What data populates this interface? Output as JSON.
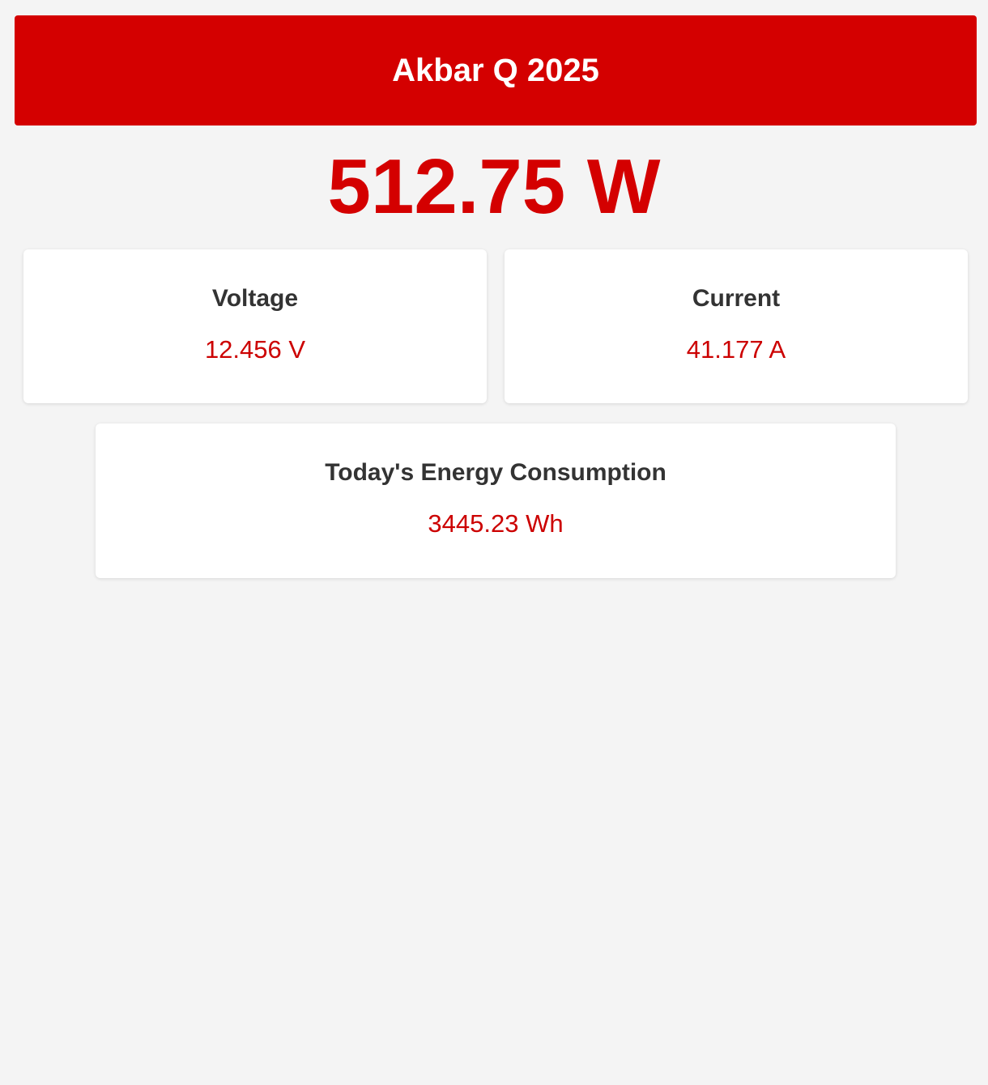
{
  "header": {
    "title": "Akbar Q 2025"
  },
  "power": {
    "value": "512.75 W"
  },
  "cards": {
    "voltage": {
      "title": "Voltage",
      "value": "12.456 V"
    },
    "current": {
      "title": "Current",
      "value": "41.177 A"
    },
    "energy": {
      "title": "Today's Energy Consumption",
      "value": "3445.23 Wh"
    }
  },
  "colors": {
    "accent": "#d40000",
    "background": "#f4f4f4",
    "card": "#ffffff",
    "heading_text": "#333333",
    "value_text": "#cc0000"
  }
}
